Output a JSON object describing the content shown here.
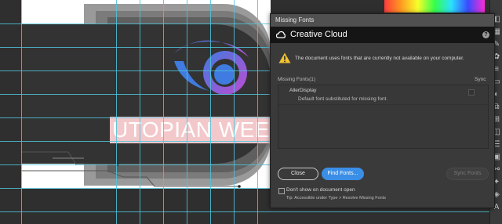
{
  "artwork": {
    "banner_text": "UTOPIAN WEE"
  },
  "dialog": {
    "window_title": "Missing Fonts",
    "header_title": "Creative Cloud",
    "help_symbol": "?",
    "warning_message": "The document uses fonts that are currently not available on your computer.",
    "list_header": "Missing Fonts(1)",
    "sync_header": "Sync",
    "missing_fonts": [
      {
        "name": "AllerDisplay",
        "note": "Default font substituted for missing font."
      }
    ],
    "buttons": {
      "close": "Close",
      "find_fonts": "Find Fonts...",
      "sync_fonts": "Sync Fonts"
    },
    "dont_show_label": "Don't show on document open",
    "tip": "Tip: Accessible under Type > Resolve Missing Fonts"
  },
  "colors": {
    "accent_button": "#3b8ee6",
    "header_bg": "#151515",
    "warning": "#f2c230",
    "guide": "#4fc3d9"
  },
  "icons": {
    "header_logo": "creative-cloud-icon",
    "warning": "warning-triangle-icon",
    "help": "help-icon"
  }
}
